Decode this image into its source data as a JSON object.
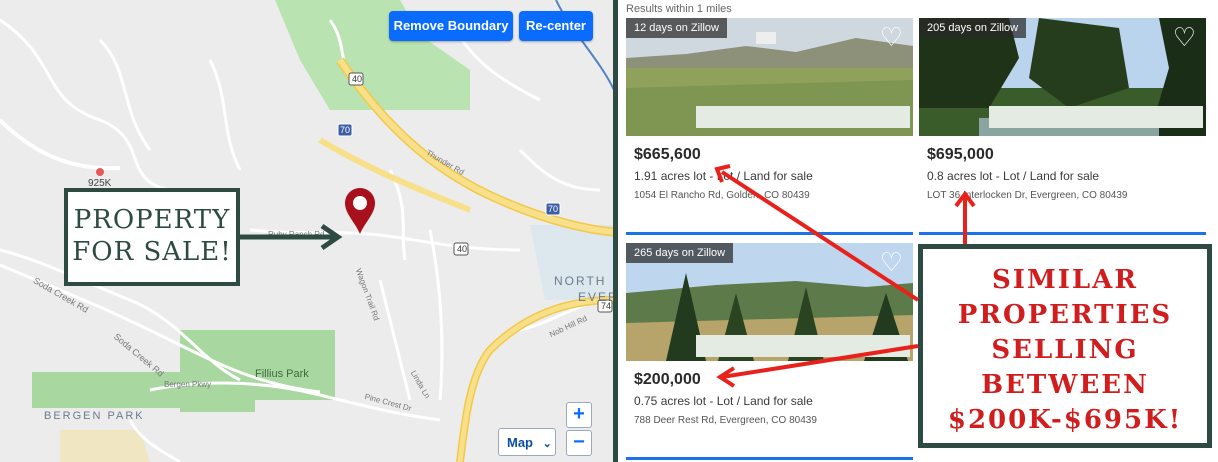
{
  "map": {
    "remove_boundary_label": "Remove Boundary",
    "recenter_label": "Re-center",
    "zoom_in": "+",
    "zoom_out": "−",
    "map_type_label": "Map",
    "price_marker": "925K",
    "place_labels": {
      "bergen_park": "BERGEN PARK",
      "fillius_park": "Fillius Park",
      "north": "NORTH",
      "ever": "EVER",
      "soda_creek_rd": "Soda Creek Rd",
      "soda_creek_rd_2": "Soda Creek Rd",
      "bergen_pkwy": "Bergen Pkwy",
      "ruby_ranch_rd": "Ruby Ranch Rd",
      "thunder_rd": "Thunder Rd",
      "pine_crest_dr": "Pine Crest Dr",
      "linda_ln": "Linda Ln",
      "wagon_trail_rd": "Wagon Trail Rd",
      "nob_hill_rd": "Nob Hill Rd",
      "hwy_40": "40",
      "hwy_70": "70",
      "hwy_74": "74",
      "i70": "I-70"
    },
    "icons": {
      "pin": "map-pin-icon"
    },
    "property_callout": {
      "line1": "PROPERTY",
      "line2": "FOR SALE!"
    },
    "colors": {
      "button_blue": "#0a6cff",
      "callout_green": "#2d4b42",
      "road_yellow": "#f5d76e",
      "park_green": "#a8d8a0"
    }
  },
  "listings": {
    "results_note": "Results within 1 miles",
    "cards": [
      {
        "badge": "12 days on Zillow",
        "price": "$665,600",
        "details": "1.91 acres lot - Lot / Land for sale",
        "address": "1054 El Rancho Rd, Golden, CO 80439"
      },
      {
        "badge": "205 days on Zillow",
        "price": "$695,000",
        "details": "0.8 acres lot - Lot / Land for sale",
        "address": "LOT 36 Interlocken Dr, Evergreen, CO 80439"
      },
      {
        "badge": "265 days on Zillow",
        "price": "$200,000",
        "details": "0.75 acres lot - Lot / Land for sale",
        "address": "788 Deer Rest Rd, Evergreen, CO 80439"
      }
    ],
    "heart_icon": "heart-outline-icon",
    "similar_callout": {
      "line1": "SIMILAR",
      "line2": "PROPERTIES",
      "line3": "SELLING",
      "line4": "BETWEEN",
      "line5": "$200K-$695K!"
    },
    "colors": {
      "callout_red": "#d11d1d",
      "arrow_red": "#e8221b"
    }
  }
}
